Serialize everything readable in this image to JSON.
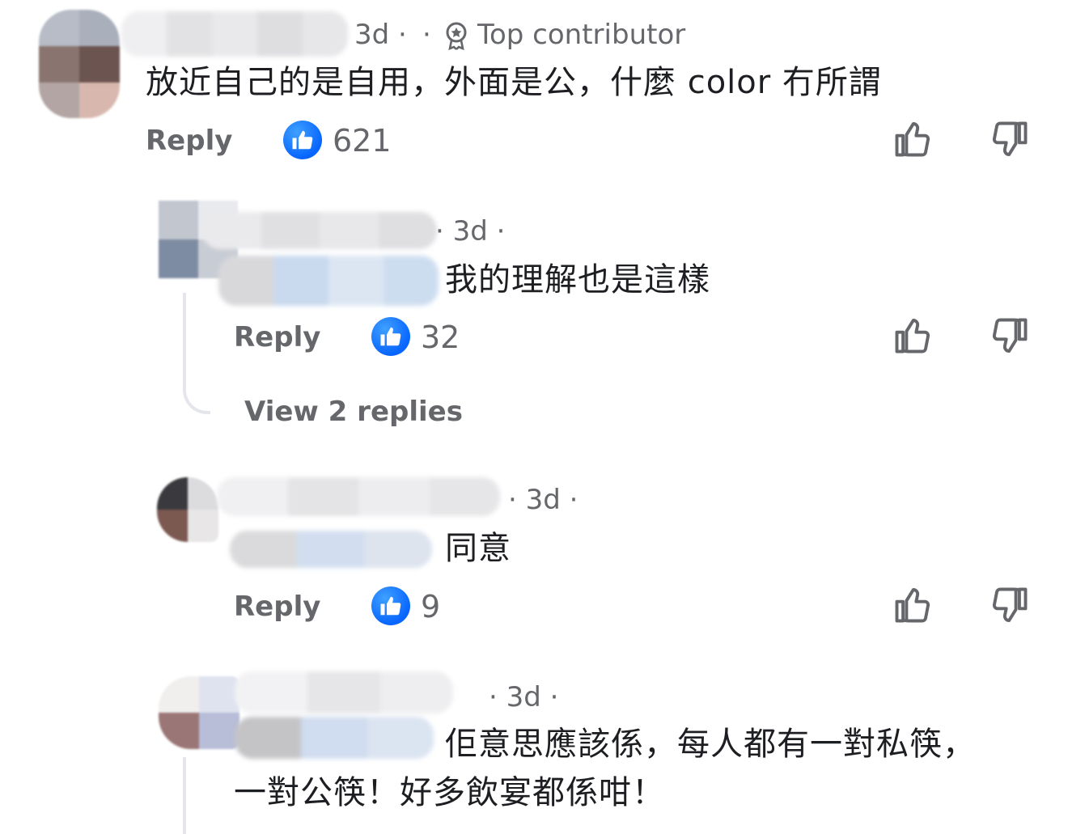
{
  "comments": [
    {
      "time_meta": "3d ·",
      "separator": "·",
      "badge_label": "Top contributor",
      "text": "放近自己的是自用，外面是公，什麼 color 冇所謂",
      "reply_label": "Reply",
      "like_count": "621"
    },
    {
      "time_meta": "· 3d ·",
      "text": "我的理解也是這樣",
      "reply_label": "Reply",
      "like_count": "32",
      "view_replies_label": "View 2 replies"
    },
    {
      "time_meta": "· 3d ·",
      "text": "同意",
      "reply_label": "Reply",
      "like_count": "9"
    },
    {
      "time_meta": "· 3d ·",
      "text_line1": "佢意思應該係，每人都有一對私筷，",
      "text_line2": "一對公筷！好多飲宴都係咁！"
    }
  ],
  "icons": {
    "like_reaction": "thumbs-up-badge-icon",
    "like_button": "thumbs-up-outline-icon",
    "dislike_button": "thumbs-down-outline-icon",
    "top_contributor": "award-badge-icon"
  },
  "colors": {
    "accent": "#0866ff",
    "secondary_text": "#65676b",
    "primary_text": "#1c1e21",
    "thread_line": "#e4e6eb"
  }
}
